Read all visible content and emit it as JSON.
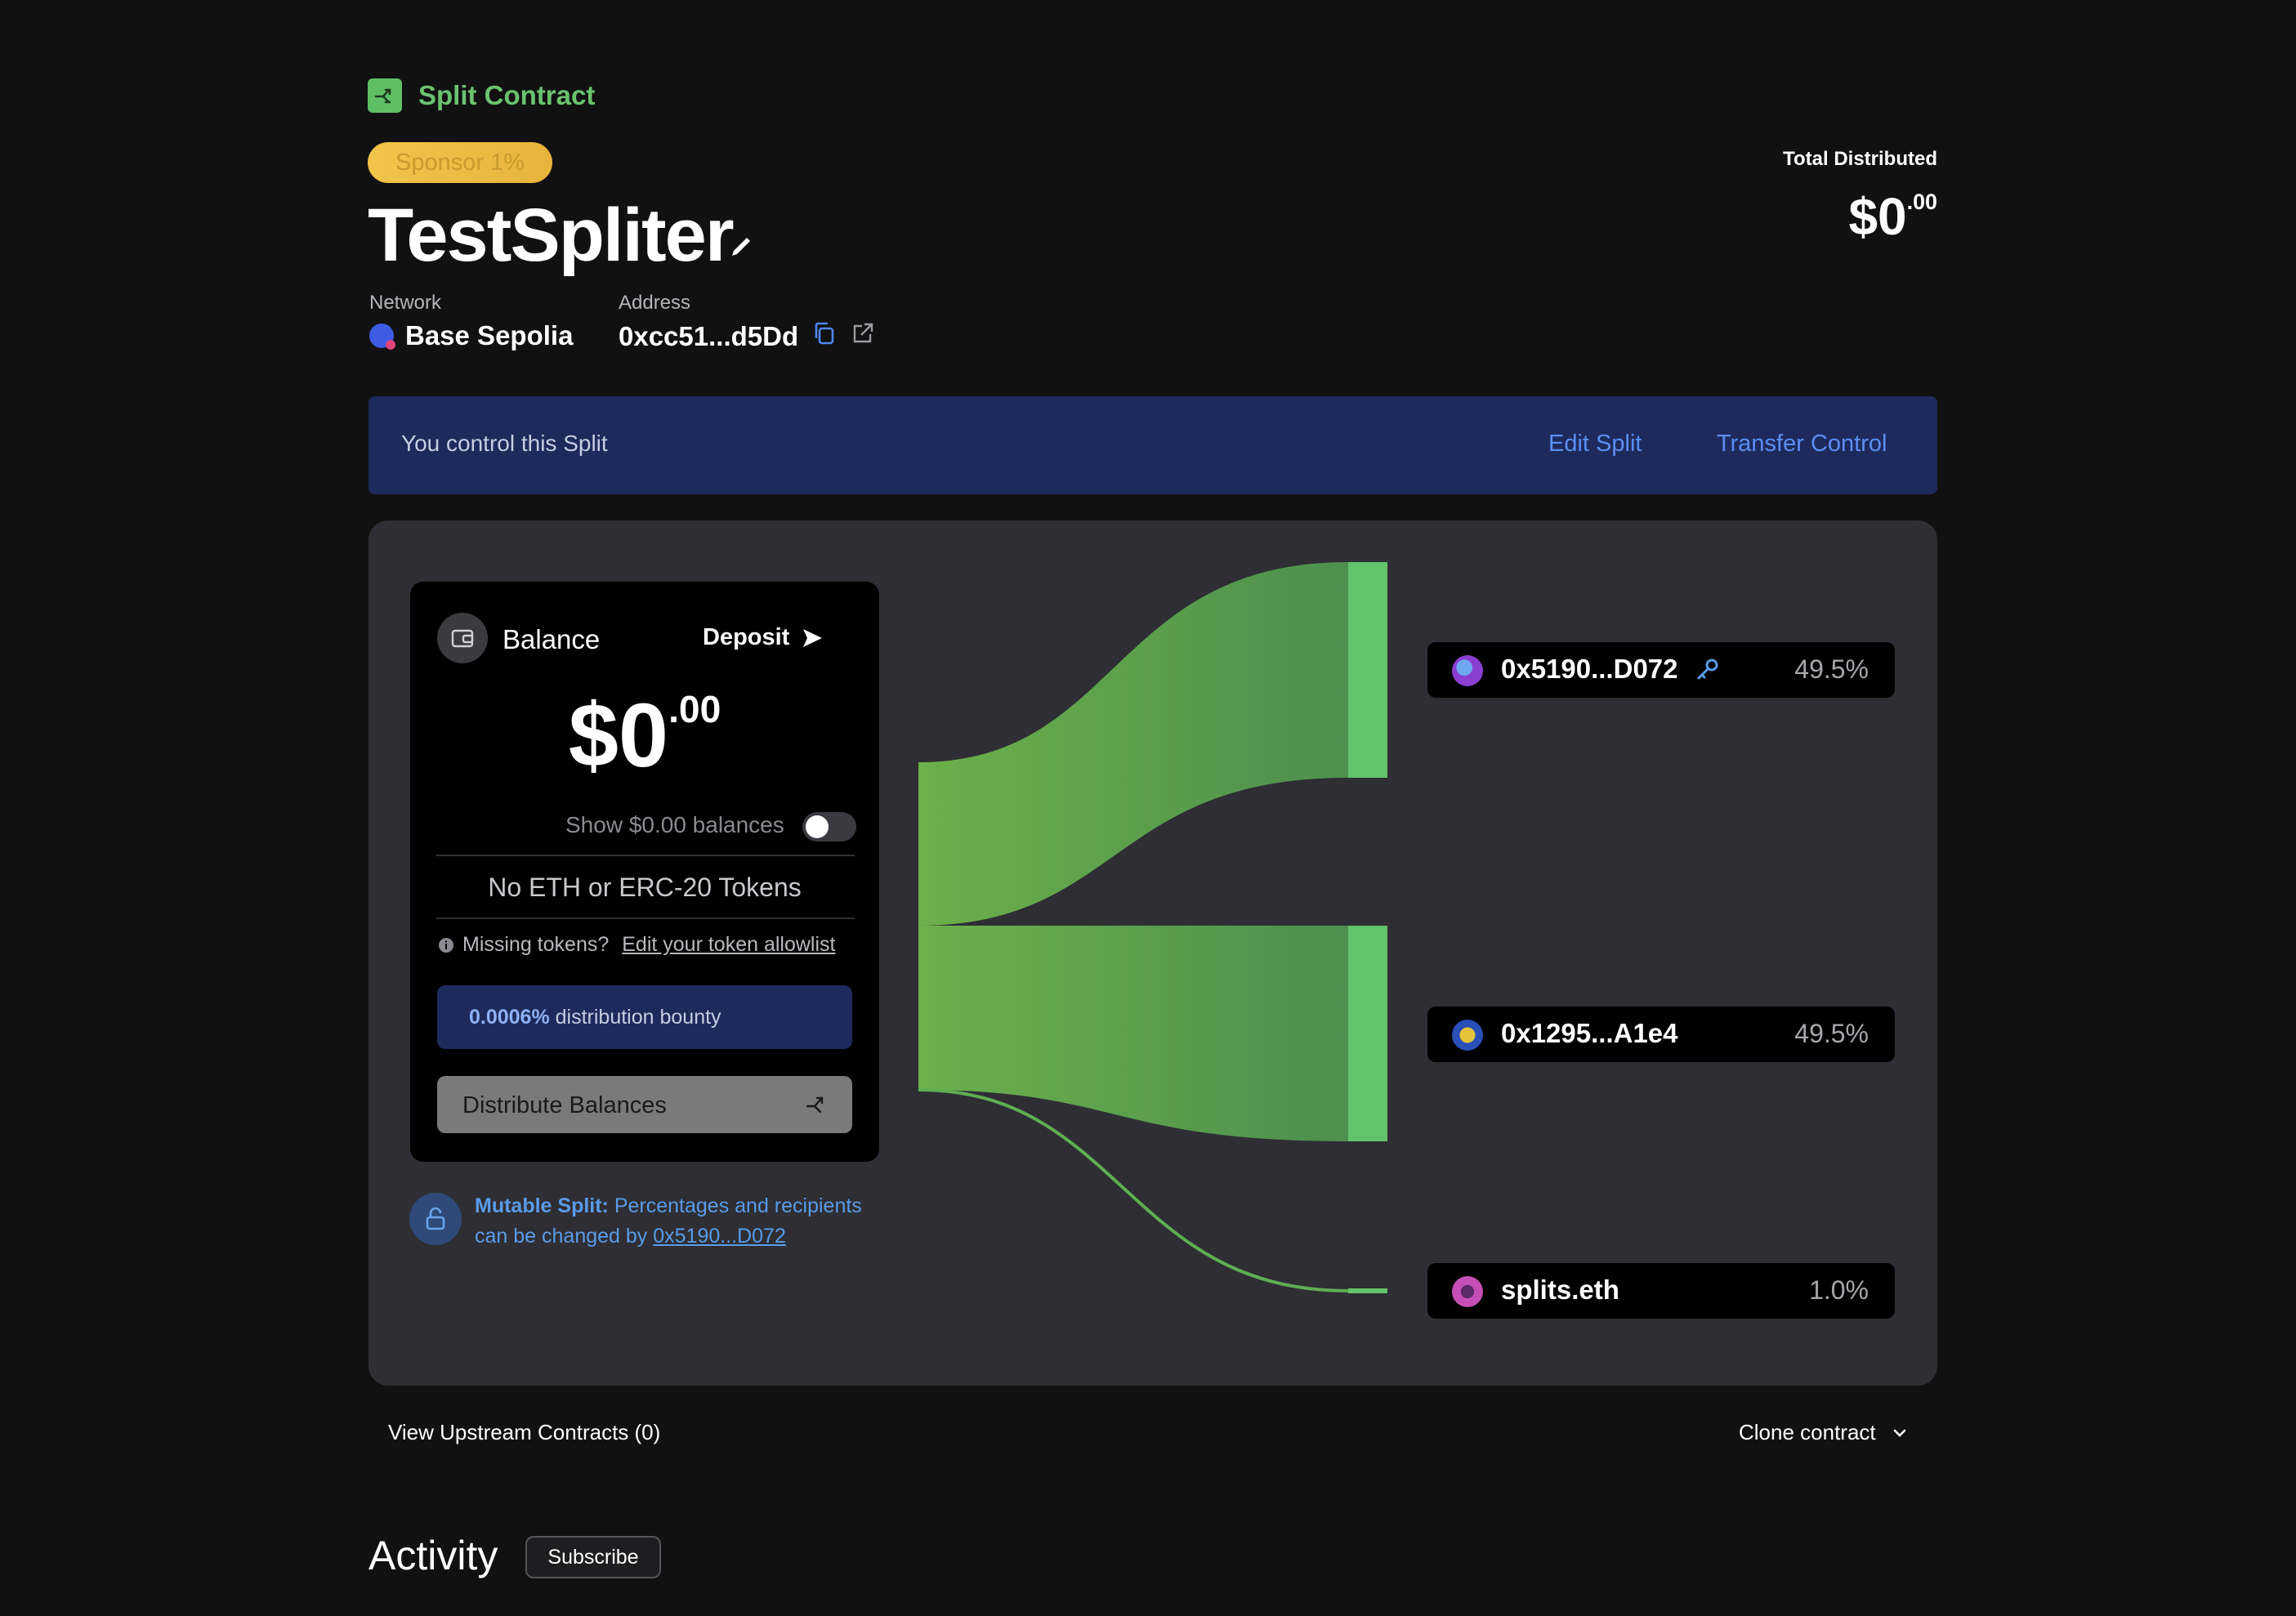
{
  "header": {
    "brand_label": "Split Contract",
    "sponsor_badge": "Sponsor 1%",
    "title": "TestSpliter",
    "network_label": "Network",
    "network_value": "Base Sepolia",
    "address_label": "Address",
    "address_value": "0xcc51...d5Dd",
    "total_label": "Total Distributed",
    "total_whole": "$0",
    "total_cents": ".00"
  },
  "banner": {
    "text": "You control this Split",
    "edit_link": "Edit Split",
    "transfer_link": "Transfer Control"
  },
  "balance": {
    "title": "Balance",
    "deposit_label": "Deposit",
    "amount_whole": "$0",
    "amount_cents": ".00",
    "show_zero_label": "Show $0.00 balances",
    "show_zero_enabled": false,
    "empty_text": "No ETH or ERC-20 Tokens",
    "missing_text": "Missing tokens?",
    "missing_link": "Edit your token allowlist",
    "bounty_pct": "0.0006%",
    "bounty_text": " distribution bounty",
    "distribute_label": "Distribute Balances"
  },
  "mutable": {
    "bold": "Mutable Split:",
    "text": " Percentages and recipients can be changed by ",
    "link": "0x5190...D072"
  },
  "recipients": [
    {
      "name": "0x5190...D072",
      "pct": "49.5%",
      "avatar_color": "#8a3fd1",
      "controller": true
    },
    {
      "name": "0x1295...A1e4",
      "pct": "49.5%",
      "avatar_color": "#2a4fb8",
      "controller": false
    },
    {
      "name": "splits.eth",
      "pct": "1.0%",
      "avatar_color": "#c64fb5",
      "controller": false
    }
  ],
  "footer": {
    "upstream_label": "View Upstream Contracts (0)",
    "clone_label": "Clone contract",
    "activity_title": "Activity",
    "subscribe_label": "Subscribe"
  },
  "colors": {
    "background": "#111112",
    "card": "#2e2e34",
    "banner": "#1e2a5c",
    "link": "#5a8ff2",
    "flow_green": "#6ab04c",
    "flow_bar": "#62c46a"
  }
}
